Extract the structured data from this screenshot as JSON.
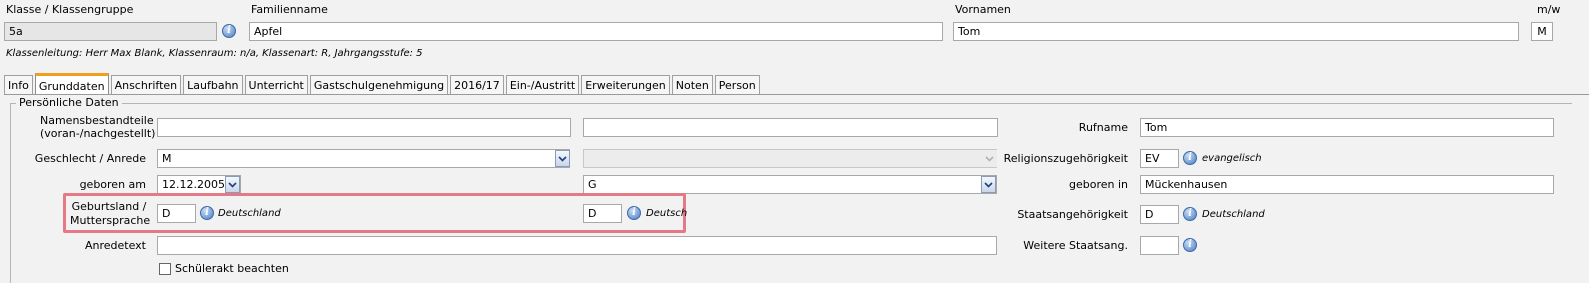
{
  "header": {
    "klasse_label": "Klasse / Klassengruppe",
    "klasse_value": "5a",
    "familienname_label": "Familienname",
    "familienname_value": "Apfel",
    "vornamen_label": "Vornamen",
    "vornamen_value": "Tom",
    "mw_label": "m/w",
    "mw_value": "M",
    "info_line": "Klassenleitung: Herr Max Blank, Klassenraum: n/a, Klassenart: R, Jahrgangsstufe: 5"
  },
  "tabs": [
    {
      "label": "Info"
    },
    {
      "label": "Grunddaten",
      "active": true
    },
    {
      "label": "Anschriften"
    },
    {
      "label": "Laufbahn"
    },
    {
      "label": "Unterricht"
    },
    {
      "label": "Gastschulgenehmigung"
    },
    {
      "label": "2016/17"
    },
    {
      "label": "Ein-/Austritt"
    },
    {
      "label": "Erweiterungen"
    },
    {
      "label": "Noten"
    },
    {
      "label": "Person"
    }
  ],
  "section": {
    "title": "Persönliche Daten",
    "namensbestandteile_label_1": "Namensbestandteile",
    "namensbestandteile_label_2": "(voran-/nachgestellt)",
    "namensbestandteile_value_1": "",
    "namensbestandteile_value_2": "",
    "rufname_label": "Rufname",
    "rufname_value": "Tom",
    "geschlecht_label": "Geschlecht / Anrede",
    "geschlecht_value": "M",
    "anrede_value": "",
    "religion_label": "Religionszugehörigkeit",
    "religion_value": "EV",
    "religion_hint": "evangelisch",
    "geboren_am_label": "geboren am",
    "geboren_am_value": "12.12.2005",
    "zweite_auswahl_value": "G",
    "geboren_in_label": "geboren in",
    "geboren_in_value": "Mückenhausen",
    "geburtsland_label_1": "Geburtsland /",
    "geburtsland_label_2": "Muttersprache",
    "geburtsland_value": "D",
    "geburtsland_hint": "Deutschland",
    "muttersprache_value": "D",
    "muttersprache_hint": "Deutsch",
    "staatsangehoerigkeit_label": "Staatsangehörigkeit",
    "staatsangehoerigkeit_value": "D",
    "staatsangehoerigkeit_hint": "Deutschland",
    "anredetext_label": "Anredetext",
    "anredetext_value": "",
    "weitere_staatsang_label": "Weitere Staatsang.",
    "weitere_staatsang_value": "",
    "schuelerakt_label": "Schülerakt beachten",
    "schuelerakt_checked": false
  },
  "icons": {
    "info_glyph": "i"
  },
  "colors": {
    "tab_accent": "#f0a020",
    "highlight": "#e57a86",
    "info_blue": "#4a7ec3"
  }
}
